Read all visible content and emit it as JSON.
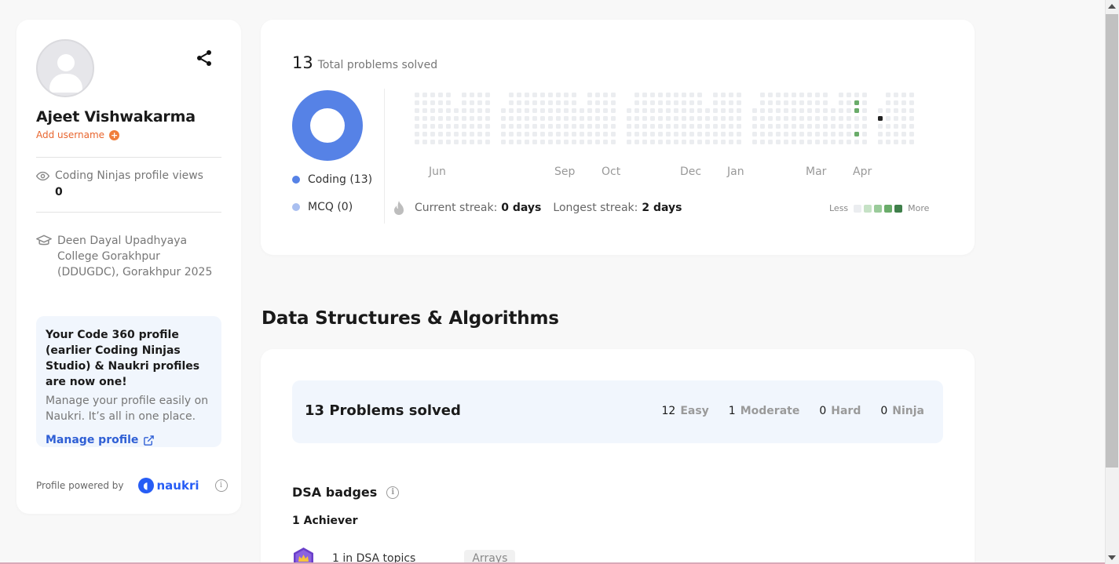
{
  "profile": {
    "name": "Ajeet Vishwakarma",
    "add_username": "Add username",
    "views_label": "Coding Ninjas profile views",
    "views_count": "0",
    "college": "Deen Dayal Upadhyaya College Gorakhpur (DDUGDC), Gorakhpur 2025",
    "promo_title": "Your Code 360 profile (earlier Coding Ninjas Studio) & Naukri profiles are now one!",
    "promo_desc": "Manage your profile easily on Naukri. It’s all in one place.",
    "manage_link": "Manage profile",
    "powered_by": "Profile powered by",
    "naukri": "naukri"
  },
  "stats": {
    "total_count": "13",
    "total_label": "Total problems solved",
    "legend": [
      {
        "label": "Coding (13)",
        "color": "#5682e6"
      },
      {
        "label": "MCQ (0)",
        "color": "#a9bff0"
      }
    ],
    "months": [
      "Jun",
      "Sep",
      "Oct",
      "Dec",
      "Jan",
      "Mar",
      "Apr"
    ],
    "current_streak_label": "Current streak:",
    "current_streak_value": "0 days",
    "longest_streak_label": "Longest streak:",
    "longest_streak_value": "2 days",
    "less": "Less",
    "more": "More",
    "heat_colors": [
      "#ebedf0",
      "#c6e2c6",
      "#9acb9a",
      "#6aac6a",
      "#3f7f4a"
    ]
  },
  "dsa": {
    "section_title": "Data Structures & Algorithms",
    "solved_title": "13 Problems solved",
    "difficulties": [
      {
        "count": "12",
        "label": "Easy"
      },
      {
        "count": "1",
        "label": "Moderate"
      },
      {
        "count": "0",
        "label": "Hard"
      },
      {
        "count": "0",
        "label": "Ninja"
      }
    ],
    "badges_title": "DSA badges",
    "achiever": "1 Achiever",
    "badge_text": "1 in DSA topics",
    "badge_topic": "Arrays"
  }
}
